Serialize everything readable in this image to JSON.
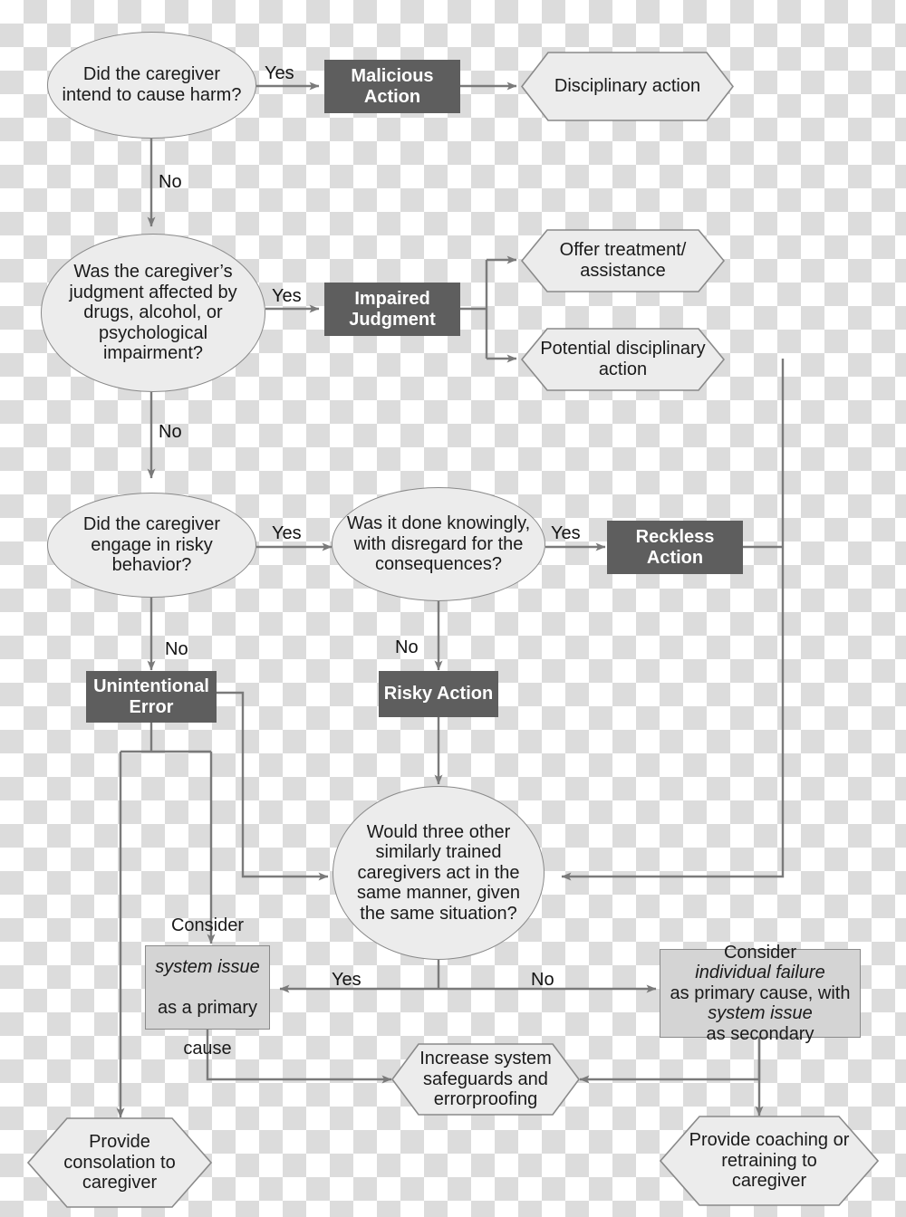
{
  "diagram": {
    "title": "Caregiver behavior accountability decision flowchart",
    "colors": {
      "dark_box_fill": "#5e5e5e",
      "dark_box_text": "#ffffff",
      "shape_fill": "#ececec",
      "gray_box_fill": "#d4d4d4",
      "stroke": "#7a7a7a",
      "text": "#1a1a1a"
    }
  },
  "decisions": {
    "intent": "Did the caregiver intend to cause harm?",
    "judgment": "Was the caregiver’s judgment affected by drugs, alcohol, or psychological impairment?",
    "risky": "Did the caregiver engage in risky behavior?",
    "knowingly": "Was it done knowingly, with disregard for the consequences?",
    "substitution": "Would three other similarly trained caregivers act in the same manner, given the same situation?"
  },
  "classifications": {
    "malicious": "Malicious Action",
    "impaired": "Impaired Judgment",
    "reckless": "Reckless Action",
    "risky_action": "Risky Action",
    "unintentional": "Unintentional Error"
  },
  "outcomes": {
    "disciplinary": "Disciplinary action",
    "offer_treatment": "Offer treatment/ assistance",
    "potential_disciplinary": "Potential disciplinary action",
    "increase_safeguards": "Increase system safeguards and errorproofing",
    "consolation": "Provide consolation to caregiver",
    "coaching": "Provide coaching or retraining to caregiver"
  },
  "causeboxes": {
    "system": {
      "line1": "Consider",
      "italic1": "system issue",
      "line2": "as a primary",
      "line3": "cause"
    },
    "individual": {
      "lead": "Consider",
      "italic1": "individual failure",
      "mid": "as primary cause, with",
      "italic2": "system issue",
      "tail": "as secondary"
    }
  },
  "edge_labels": {
    "yes1": "Yes",
    "no1": "No",
    "yes2": "Yes",
    "no2": "No",
    "yes3": "Yes",
    "no3": "No",
    "yes4": "Yes",
    "no4": "No",
    "yes5": "Yes",
    "no5": "No"
  }
}
